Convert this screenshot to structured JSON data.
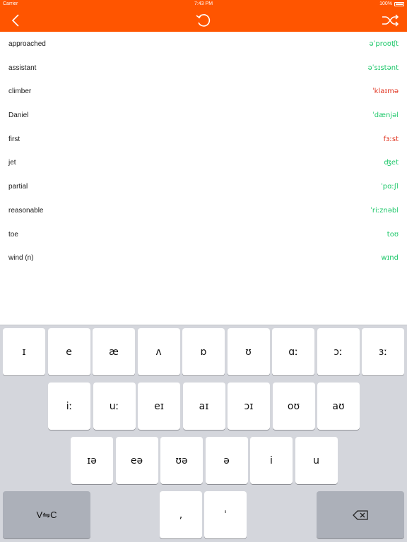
{
  "status_bar": {
    "carrier": "Carrier",
    "time": "7:43 PM",
    "battery": "100%"
  },
  "colors": {
    "accent": "#ff5500",
    "ipa_green": "#1fc86b",
    "ipa_red": "#e0331f"
  },
  "nav": {
    "back_icon": "chevron-left-icon",
    "refresh_icon": "refresh-icon",
    "shuffle_icon": "shuffle-icon"
  },
  "words": [
    {
      "word": "approached",
      "ipa": "əˈproʊʧt",
      "status": "green"
    },
    {
      "word": "assistant",
      "ipa": "əˈsɪstənt",
      "status": "green"
    },
    {
      "word": "climber",
      "ipa": "ˈklaɪmə",
      "status": "red"
    },
    {
      "word": "Daniel",
      "ipa": "ˈdænjəl",
      "status": "green"
    },
    {
      "word": "first",
      "ipa": "fɜːst",
      "status": "red"
    },
    {
      "word": "jet",
      "ipa": "ʤet",
      "status": "green"
    },
    {
      "word": "partial",
      "ipa": "ˈpɑːʃl",
      "status": "green"
    },
    {
      "word": "reasonable",
      "ipa": "ˈriːznəbl",
      "status": "green"
    },
    {
      "word": "toe",
      "ipa": "toʊ",
      "status": "green"
    },
    {
      "word": "wind (n)",
      "ipa": "wɪnd",
      "status": "green"
    }
  ],
  "keyboard": {
    "row1": [
      "ɪ",
      "e",
      "æ",
      "ʌ",
      "ɒ",
      "ʊ",
      "ɑː",
      "ɔː",
      "ɜː"
    ],
    "row2": [
      "iː",
      "uː",
      "eɪ",
      "aɪ",
      "ɔɪ",
      "oʊ",
      "aʊ"
    ],
    "row3": [
      "ɪə",
      "eə",
      "ʊə",
      "ə",
      "i",
      "u"
    ],
    "switch_label": "V⇋C",
    "comma": ",",
    "stress": "ˈ",
    "delete_icon": "backspace-icon"
  }
}
